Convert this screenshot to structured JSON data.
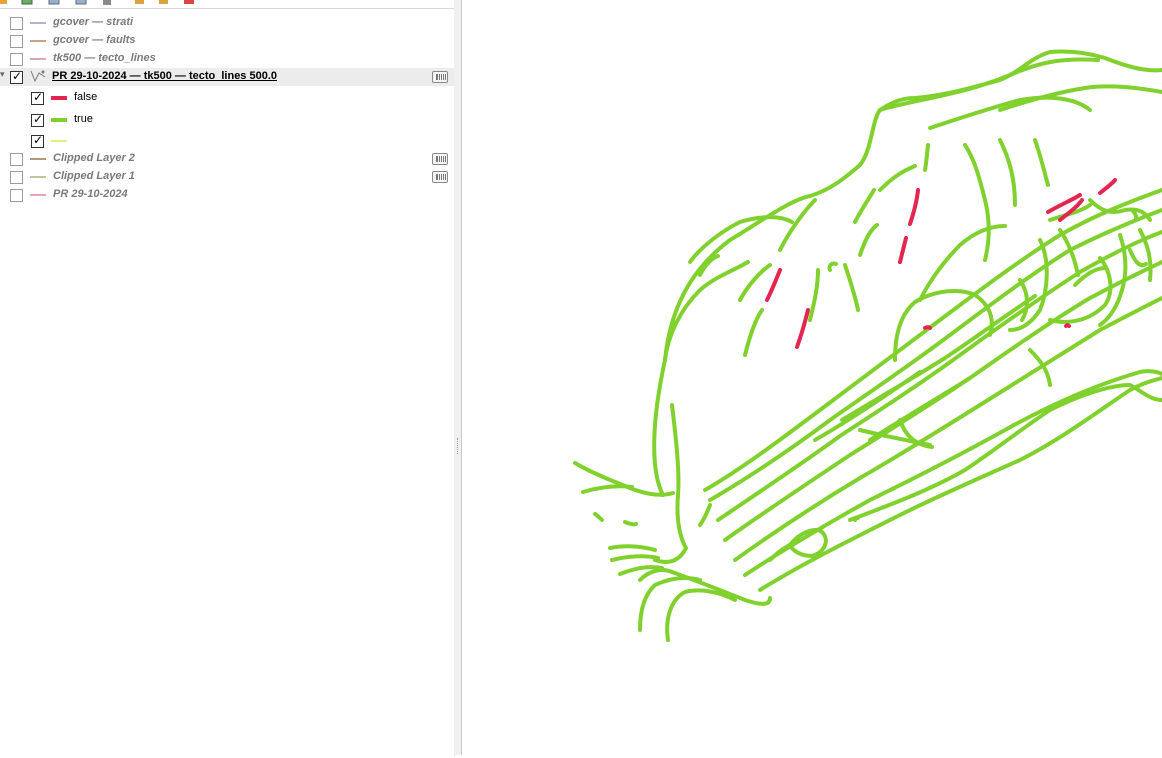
{
  "colors": {
    "true_line": "#80d12e",
    "false_line": "#e3264f",
    "null_line": "#e6ef7e",
    "selected_row_bg": "#ececec"
  },
  "toolbar": {
    "icons": [
      "layer-add-icon",
      "expand-icon",
      "filter-icon",
      "sort-icon",
      "lock-icon",
      "select-icon",
      "remove-layer-icon"
    ]
  },
  "layers": [
    {
      "name": "gcover — strati",
      "checked": false,
      "swatch": "#b4b2cf"
    },
    {
      "name": "gcover — faults",
      "checked": false,
      "swatch": "#c9a383"
    },
    {
      "name": "tk500 — tecto_lines",
      "checked": false,
      "swatch": "#d7a8b9"
    },
    {
      "name": "PR 29-10-2024 — tk500 — tecto_lines 500.0",
      "checked": true,
      "selected": true,
      "filtered": true,
      "legend": [
        {
          "label": "false",
          "checked": true,
          "color": "#e3264f"
        },
        {
          "label": "true",
          "checked": true,
          "color": "#80d12e"
        },
        {
          "label": "",
          "checked": true,
          "color": "#e6ef7e"
        }
      ]
    },
    {
      "name": "Clipped Layer 2",
      "checked": false,
      "swatch": "#b99678",
      "filtered": true
    },
    {
      "name": "Clipped Layer 1",
      "checked": false,
      "swatch": "#b9c99a",
      "filtered": true
    },
    {
      "name": "PR 29-10-2024",
      "checked": false,
      "swatch": "#e7a6b6"
    }
  ]
}
